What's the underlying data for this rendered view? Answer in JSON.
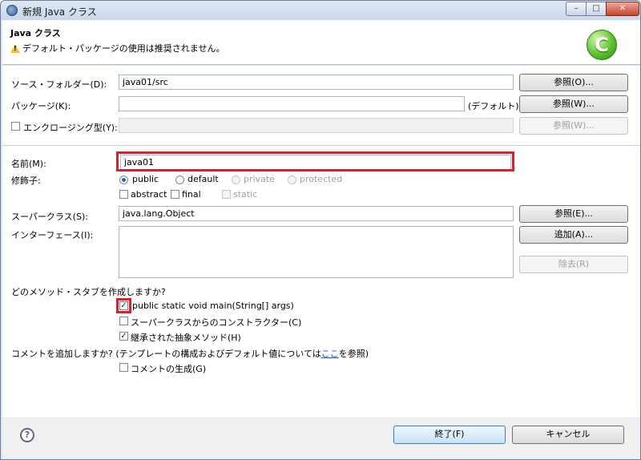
{
  "window": {
    "title": "新規 Java クラス",
    "min_glyph": "–",
    "max_glyph": "□",
    "close_glyph": "✕"
  },
  "header": {
    "title": "Java クラス",
    "warning": "デフォルト・パッケージの使用は推奨されません。",
    "logo_letter": "C"
  },
  "form": {
    "source_folder": {
      "label": "ソース・フォルダー(D):",
      "value": "java01/src",
      "button": "参照(O)..."
    },
    "package": {
      "label": "パッケージ(K):",
      "value": "",
      "default_note": "(デフォルト)",
      "button": "参照(W)..."
    },
    "enclosing": {
      "label": "エンクロージング型(Y):",
      "value": "",
      "button": "参照(W)..."
    },
    "name": {
      "label": "名前(M):",
      "value": "java01"
    },
    "modifiers": {
      "label": "修飾子:",
      "access": [
        {
          "label": "public",
          "checked": true,
          "enabled": true
        },
        {
          "label": "default",
          "checked": false,
          "enabled": true
        },
        {
          "label": "private",
          "checked": false,
          "enabled": false
        },
        {
          "label": "protected",
          "checked": false,
          "enabled": false
        }
      ],
      "flags": [
        {
          "label": "abstract",
          "checked": false,
          "enabled": true
        },
        {
          "label": "final",
          "checked": false,
          "enabled": true
        },
        {
          "label": "static",
          "checked": false,
          "enabled": false
        }
      ]
    },
    "superclass": {
      "label": "スーパークラス(S):",
      "value": "java.lang.Object",
      "button": "参照(E)..."
    },
    "interfaces": {
      "label": "インターフェース(I):",
      "add_button": "追加(A)...",
      "remove_button": "除去(R)"
    },
    "stubs": {
      "question": "どのメソッド・スタブを作成しますか?",
      "main": {
        "label": "public static void main(String[] args)",
        "checked": true
      },
      "ctors": {
        "label": "スーパークラスからのコンストラクター(C)",
        "checked": false
      },
      "inherited": {
        "label": "継承された抽象メソッド(H)",
        "checked": true
      }
    },
    "comments": {
      "question_pre": "コメントを追加しますか? (テンプレートの構成およびデフォルト値については",
      "question_link": "ここ",
      "question_post": "を参照)",
      "generate": {
        "label": "コメントの生成(G)",
        "checked": false
      }
    }
  },
  "footer": {
    "help_glyph": "?",
    "finish": "終了(F)",
    "cancel": "キャンセル"
  },
  "colors": {
    "highlight": "#e01d2a"
  }
}
